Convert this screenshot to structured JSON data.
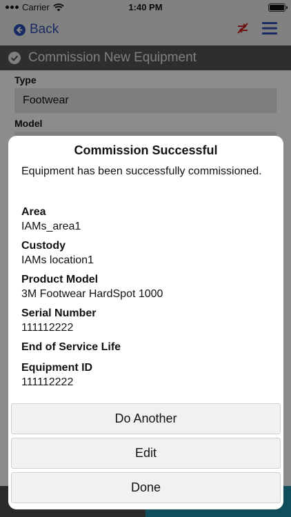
{
  "status_bar": {
    "carrier": "Carrier",
    "time": "1:40 PM",
    "battery_level": 1.0
  },
  "nav_bar": {
    "back_label": "Back",
    "back_icon": "circle-arrow-left-icon",
    "sync_icon": "sync-off-icon",
    "menu_icon": "hamburger-menu-icon",
    "accent_color": "#2d4fb3",
    "alert_color": "#cc2222"
  },
  "section_header": {
    "title": "Commission New Equipment",
    "icon": "check-circle-icon"
  },
  "form": {
    "type_label": "Type",
    "type_value": "Footwear",
    "model_label": "Model"
  },
  "dialog": {
    "title": "Commission Successful",
    "message": "Equipment has been successfully commissioned.",
    "fields": [
      {
        "label": "Area",
        "value": "IAMs_area1"
      },
      {
        "label": "Custody",
        "value": "IAMs location1"
      },
      {
        "label": "Product Model",
        "value": "3M Footwear HardSpot 1000"
      },
      {
        "label": "Serial Number",
        "value": "111112222"
      },
      {
        "label": "End of Service Life",
        "value": ""
      },
      {
        "label": "Equipment ID",
        "value": "111112222"
      }
    ],
    "buttons": {
      "do_another": "Do Another",
      "edit": "Edit",
      "done": "Done"
    }
  }
}
